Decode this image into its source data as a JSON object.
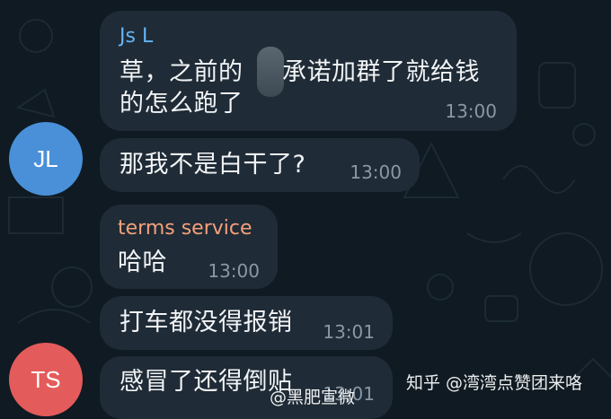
{
  "colors": {
    "background": "#0f1a22",
    "bubble": "#1f2b36",
    "sender_jsl": "#64b5f6",
    "sender_terms": "#f5a07a",
    "avatar_jl": "#4a90d9",
    "avatar_ts": "#e45b5b",
    "timestamp": "#8a98a6"
  },
  "messages": [
    {
      "sender": "Js L",
      "line1_before": "草，之前的",
      "line1_after": "承诺加群了就给钱",
      "line2": "的怎么跑了",
      "time": "13:00"
    },
    {
      "text": "那我不是白干了?",
      "time": "13:00"
    },
    {
      "sender": "terms service",
      "text": "哈哈",
      "time": "13:00"
    },
    {
      "text": "打车都没得报销",
      "time": "13:01"
    },
    {
      "text": "感冒了还得倒贴",
      "time": "13:01"
    }
  ],
  "avatars": {
    "jl": {
      "initials": "JL"
    },
    "ts": {
      "initials": "TS"
    }
  },
  "watermarks": {
    "center": "@黑肥宣微",
    "right": "知乎 @湾湾点赞团来咯"
  },
  "icons": [
    "doodle-background-pattern",
    "zhihu-watermark"
  ]
}
